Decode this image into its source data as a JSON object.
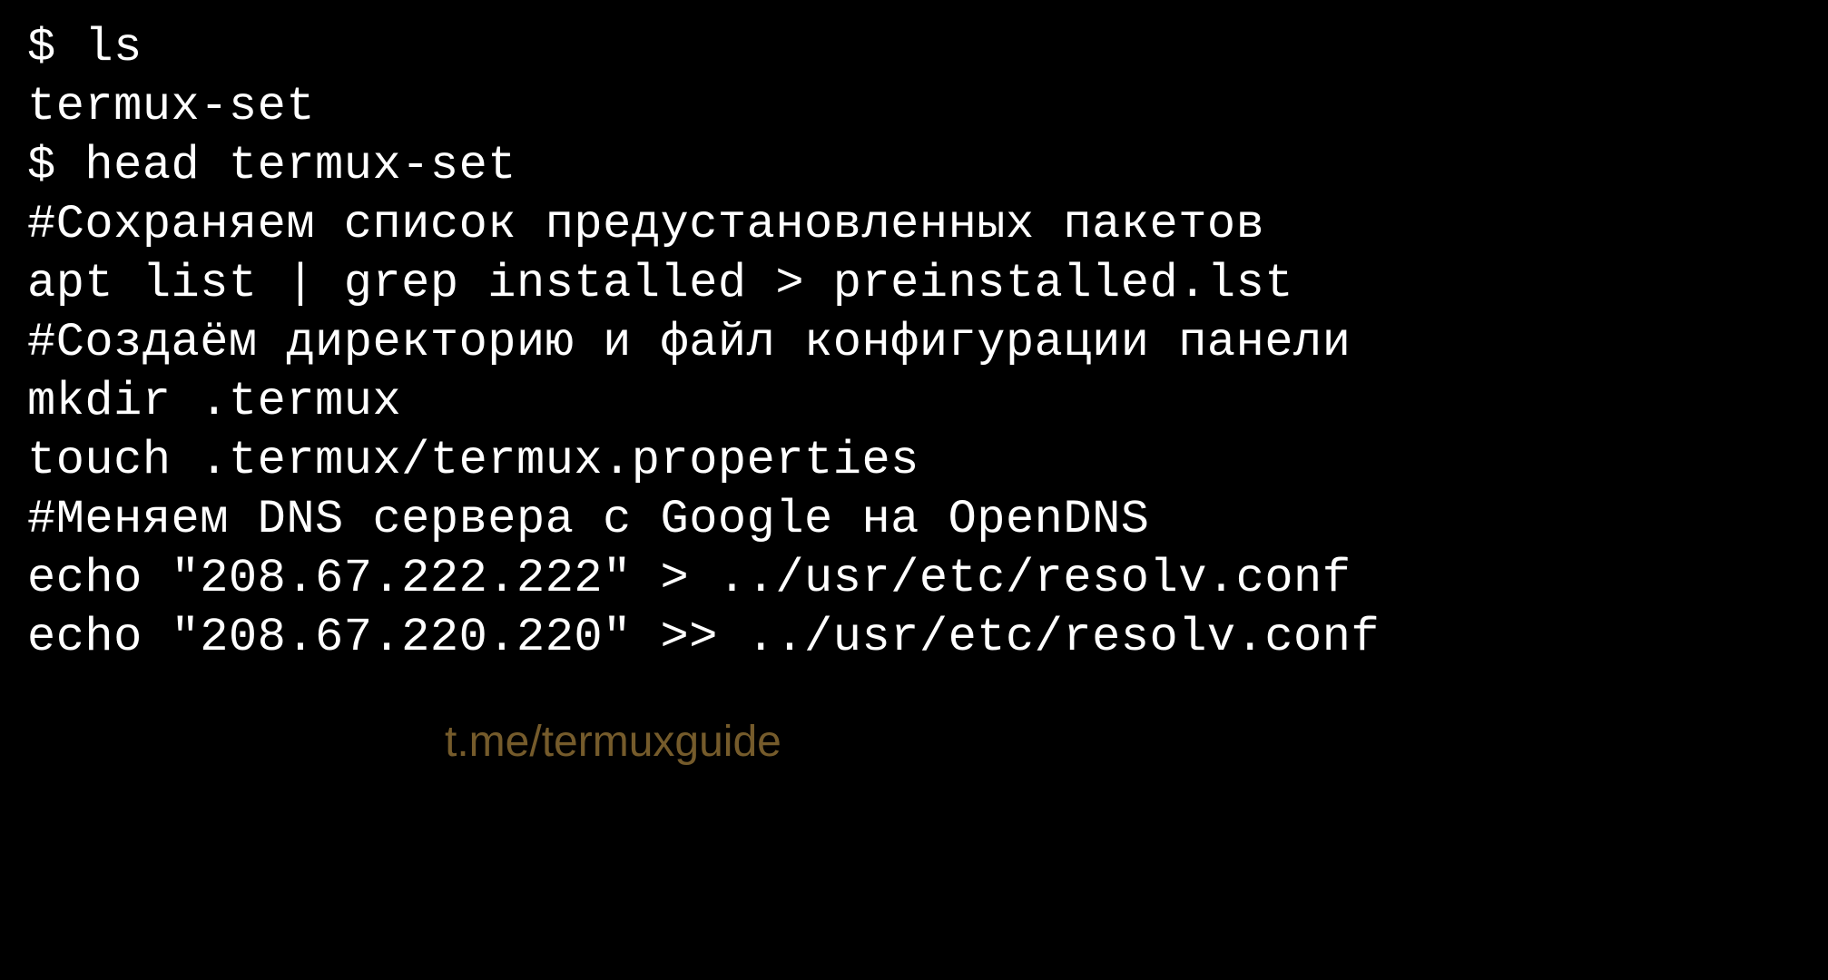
{
  "terminal": {
    "lines": [
      "$ ls",
      "termux-set",
      "$ head termux-set",
      "#Сохраняем список предустановленных пакетов",
      "apt list | grep installed > preinstalled.lst",
      "",
      "#Создаём директорию и файл конфигурации панели",
      "mkdir .termux",
      "touch .termux/termux.properties",
      "",
      "#Меняем DNS сервера с Google на OpenDNS",
      "echo \"208.67.222.222\" > ../usr/etc/resolv.conf",
      "echo \"208.67.220.220\" >> ../usr/etc/resolv.conf"
    ]
  },
  "watermark": "t.me/termuxguide"
}
